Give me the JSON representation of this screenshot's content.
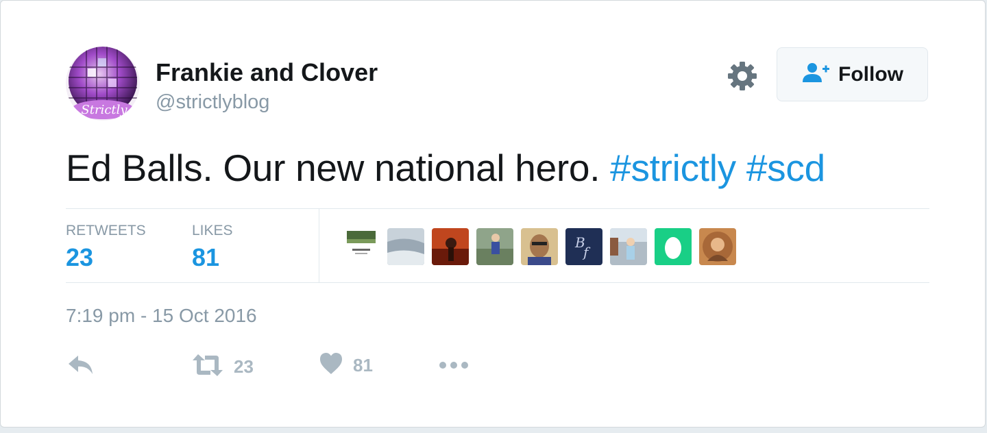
{
  "user": {
    "name": "Frankie and Clover",
    "handle": "@strictlyblog",
    "avatar_text": "Strictly"
  },
  "follow_label": "Follow",
  "tweet": {
    "text": "Ed Balls. Our new national hero.",
    "hashtags": [
      "#strictly",
      "#scd"
    ]
  },
  "stats": {
    "retweets_label": "RETWEETS",
    "retweets": "23",
    "likes_label": "LIKES",
    "likes": "81"
  },
  "timestamp": "7:19 pm - 15 Oct 2016",
  "actions": {
    "retweet_count": "23",
    "like_count": "81"
  },
  "colors": {
    "accent": "#1b95e0",
    "muted": "#8899a6",
    "icon": "#aab8c2"
  },
  "icons": [
    "gear-icon",
    "follow-person-icon",
    "reply-icon",
    "retweet-icon",
    "heart-icon",
    "more-icon"
  ]
}
